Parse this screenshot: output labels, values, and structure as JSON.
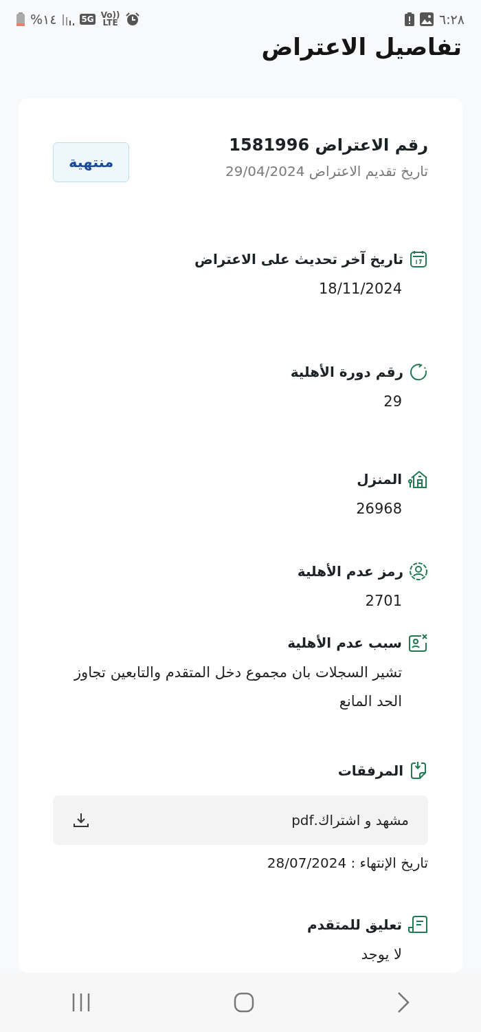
{
  "status_bar": {
    "time": "٦:٢٨",
    "battery": "%١٤",
    "network": "5G",
    "volte_top": "Vo))",
    "volte_bottom": "LTE"
  },
  "page_title": "تفاصيل الاعتراض",
  "objection": {
    "number_label": "رقم الاعتراض 1581996",
    "submitted": "تاريخ تقديم الاعتراض 29/04/2024",
    "status": "منتهية"
  },
  "sections": [
    {
      "kind": "field",
      "label": "تاريخ آخر تحديث على الاعتراض",
      "value": "18/11/2024"
    },
    {
      "kind": "field",
      "label": "رقم دورة الأهلية",
      "value": "29"
    },
    {
      "kind": "field",
      "label": "المنزل",
      "value": "26968"
    },
    {
      "kind": "field",
      "label": "رمز عدم الأهلية",
      "value": "2701"
    },
    {
      "kind": "field",
      "label": "سبب عدم الأهلية",
      "value": "تشير السجلات بان مجموع دخل المتقدم والتابعين تجاوز الحد المانع"
    },
    {
      "kind": "attachments",
      "label": "المرفقات",
      "file": "مشهد و اشتراك.pdf",
      "expiry": "تاريخ الإنتهاء : 28/07/2024"
    },
    {
      "kind": "field",
      "label": "تعليق للمتقدم",
      "value": "لا يوجد"
    }
  ]
}
